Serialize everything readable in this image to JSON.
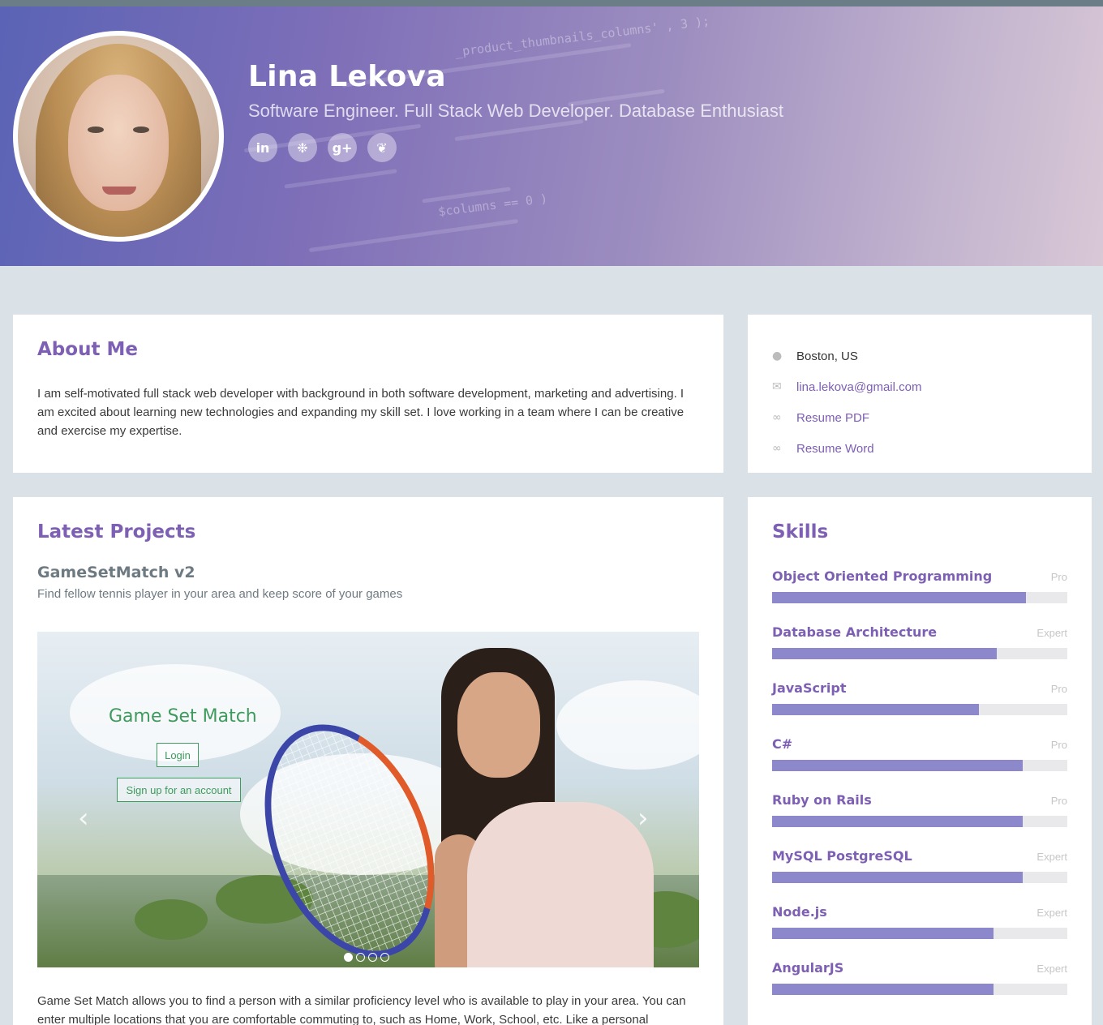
{
  "profile": {
    "name": "Lina Lekova",
    "tagline": "Software Engineer. Full Stack Web Developer. Database Enthusiast",
    "social": [
      {
        "icon": "linkedin-icon",
        "glyph": "in"
      },
      {
        "icon": "github-icon",
        "glyph": "❉"
      },
      {
        "icon": "google-plus-icon",
        "glyph": "g+"
      },
      {
        "icon": "twitter-icon",
        "glyph": "❦"
      }
    ]
  },
  "about": {
    "title": "About Me",
    "text": "I am self-motivated full stack web developer with background in both software development, marketing and advertising. I am excited about learning new technologies and expanding my skill set. I love working in a team where I can be creative and exercise my expertise."
  },
  "contact": {
    "location": "Boston, US",
    "email": "lina.lekova@gmail.com",
    "resume_pdf": "Resume PDF",
    "resume_word": "Resume Word"
  },
  "projects": {
    "title": "Latest Projects",
    "project": {
      "name": "GameSetMatch v2",
      "subtitle": "Find fellow tennis player in your area and keep score of your games",
      "slide_title": "Game Set Match",
      "login_label": "Login",
      "signup_label": "Sign up for an account",
      "description": "Game Set Match allows you to find a person with a similar proficiency level who is available to play in your area. You can enter multiple locations that you are comfortable commuting to, such as Home, Work, School, etc. Like a personal"
    },
    "carousel": {
      "slides": 4,
      "active": 1
    }
  },
  "skills": {
    "title": "Skills",
    "items": [
      {
        "name": "Object Oriented Programming",
        "level": "Pro",
        "value": 86
      },
      {
        "name": "Database Architecture",
        "level": "Expert",
        "value": 76
      },
      {
        "name": "JavaScript",
        "level": "Pro",
        "value": 70
      },
      {
        "name": "C#",
        "level": "Pro",
        "value": 85
      },
      {
        "name": "Ruby on Rails",
        "level": "Pro",
        "value": 85
      },
      {
        "name": "MySQL PostgreSQL",
        "level": "Expert",
        "value": 85
      },
      {
        "name": "Node.js",
        "level": "Expert",
        "value": 75
      },
      {
        "name": "AngularJS",
        "level": "Expert",
        "value": 75
      }
    ]
  },
  "colors": {
    "accent": "#7d5fb3",
    "bar": "#8d88cb",
    "page_bg": "#dae2e8"
  }
}
